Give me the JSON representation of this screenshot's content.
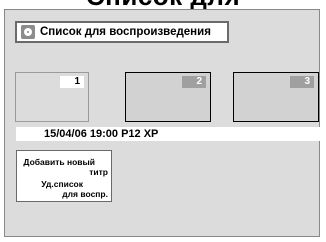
{
  "page_title": "Список для воспроизведения",
  "header": {
    "icon": "disc-icon",
    "title": "Список для воспроизведения"
  },
  "thumbnails": [
    {
      "number": "1",
      "selected": true
    },
    {
      "number": "2",
      "selected": false
    },
    {
      "number": "3",
      "selected": false
    }
  ],
  "info": {
    "text": "15/04/06  19:00  P12  XP"
  },
  "menu": {
    "items": [
      {
        "line1": "Добавить новый",
        "line2": "титр"
      },
      {
        "line1": "Уд.список",
        "line2": "для воспр."
      }
    ]
  },
  "colors": {
    "screen_bg": "#dcdcdc",
    "thumb_bg": "#d2d2d2",
    "number_badge_inactive": "#a0a0a0"
  }
}
